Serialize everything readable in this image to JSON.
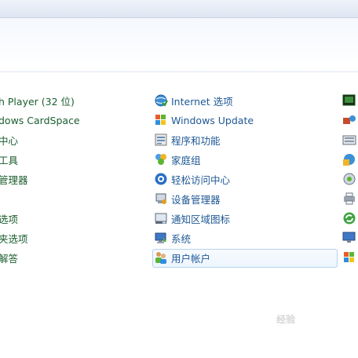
{
  "left_column": [
    {
      "label": "h Player (32 位)"
    },
    {
      "label": "dows CardSpace"
    },
    {
      "label": "中心"
    },
    {
      "label": "工具"
    },
    {
      "label": "管理器"
    },
    {
      "label": ""
    },
    {
      "label": "选项"
    },
    {
      "label": "夹选项"
    },
    {
      "label": "解答"
    }
  ],
  "middle_column": [
    {
      "label": "Internet 选项",
      "icon": "internet-options-icon"
    },
    {
      "label": "Windows Update",
      "icon": "windows-update-icon"
    },
    {
      "label": "程序和功能",
      "icon": "programs-features-icon"
    },
    {
      "label": "家庭组",
      "icon": "homegroup-icon"
    },
    {
      "label": "轻松访问中心",
      "icon": "ease-of-access-icon"
    },
    {
      "label": "设备管理器",
      "icon": "device-manager-icon"
    },
    {
      "label": "通知区域图标",
      "icon": "notification-area-icon"
    },
    {
      "label": "系统",
      "icon": "system-icon"
    },
    {
      "label": "用户帐户",
      "icon": "user-accounts-icon",
      "selected": true
    }
  ],
  "right_column_icons": [
    "monitor-icon",
    "network-icon",
    "keyboard-icon",
    "region-icon",
    "location-icon",
    "printer-icon",
    "sync-icon",
    "display-icon",
    "windows-icon"
  ],
  "watermark": {
    "text": "经验"
  },
  "colors": {
    "link": "#1f5895",
    "left_link": "#1b5d2f",
    "highlight_border": "#b7d2ee"
  }
}
